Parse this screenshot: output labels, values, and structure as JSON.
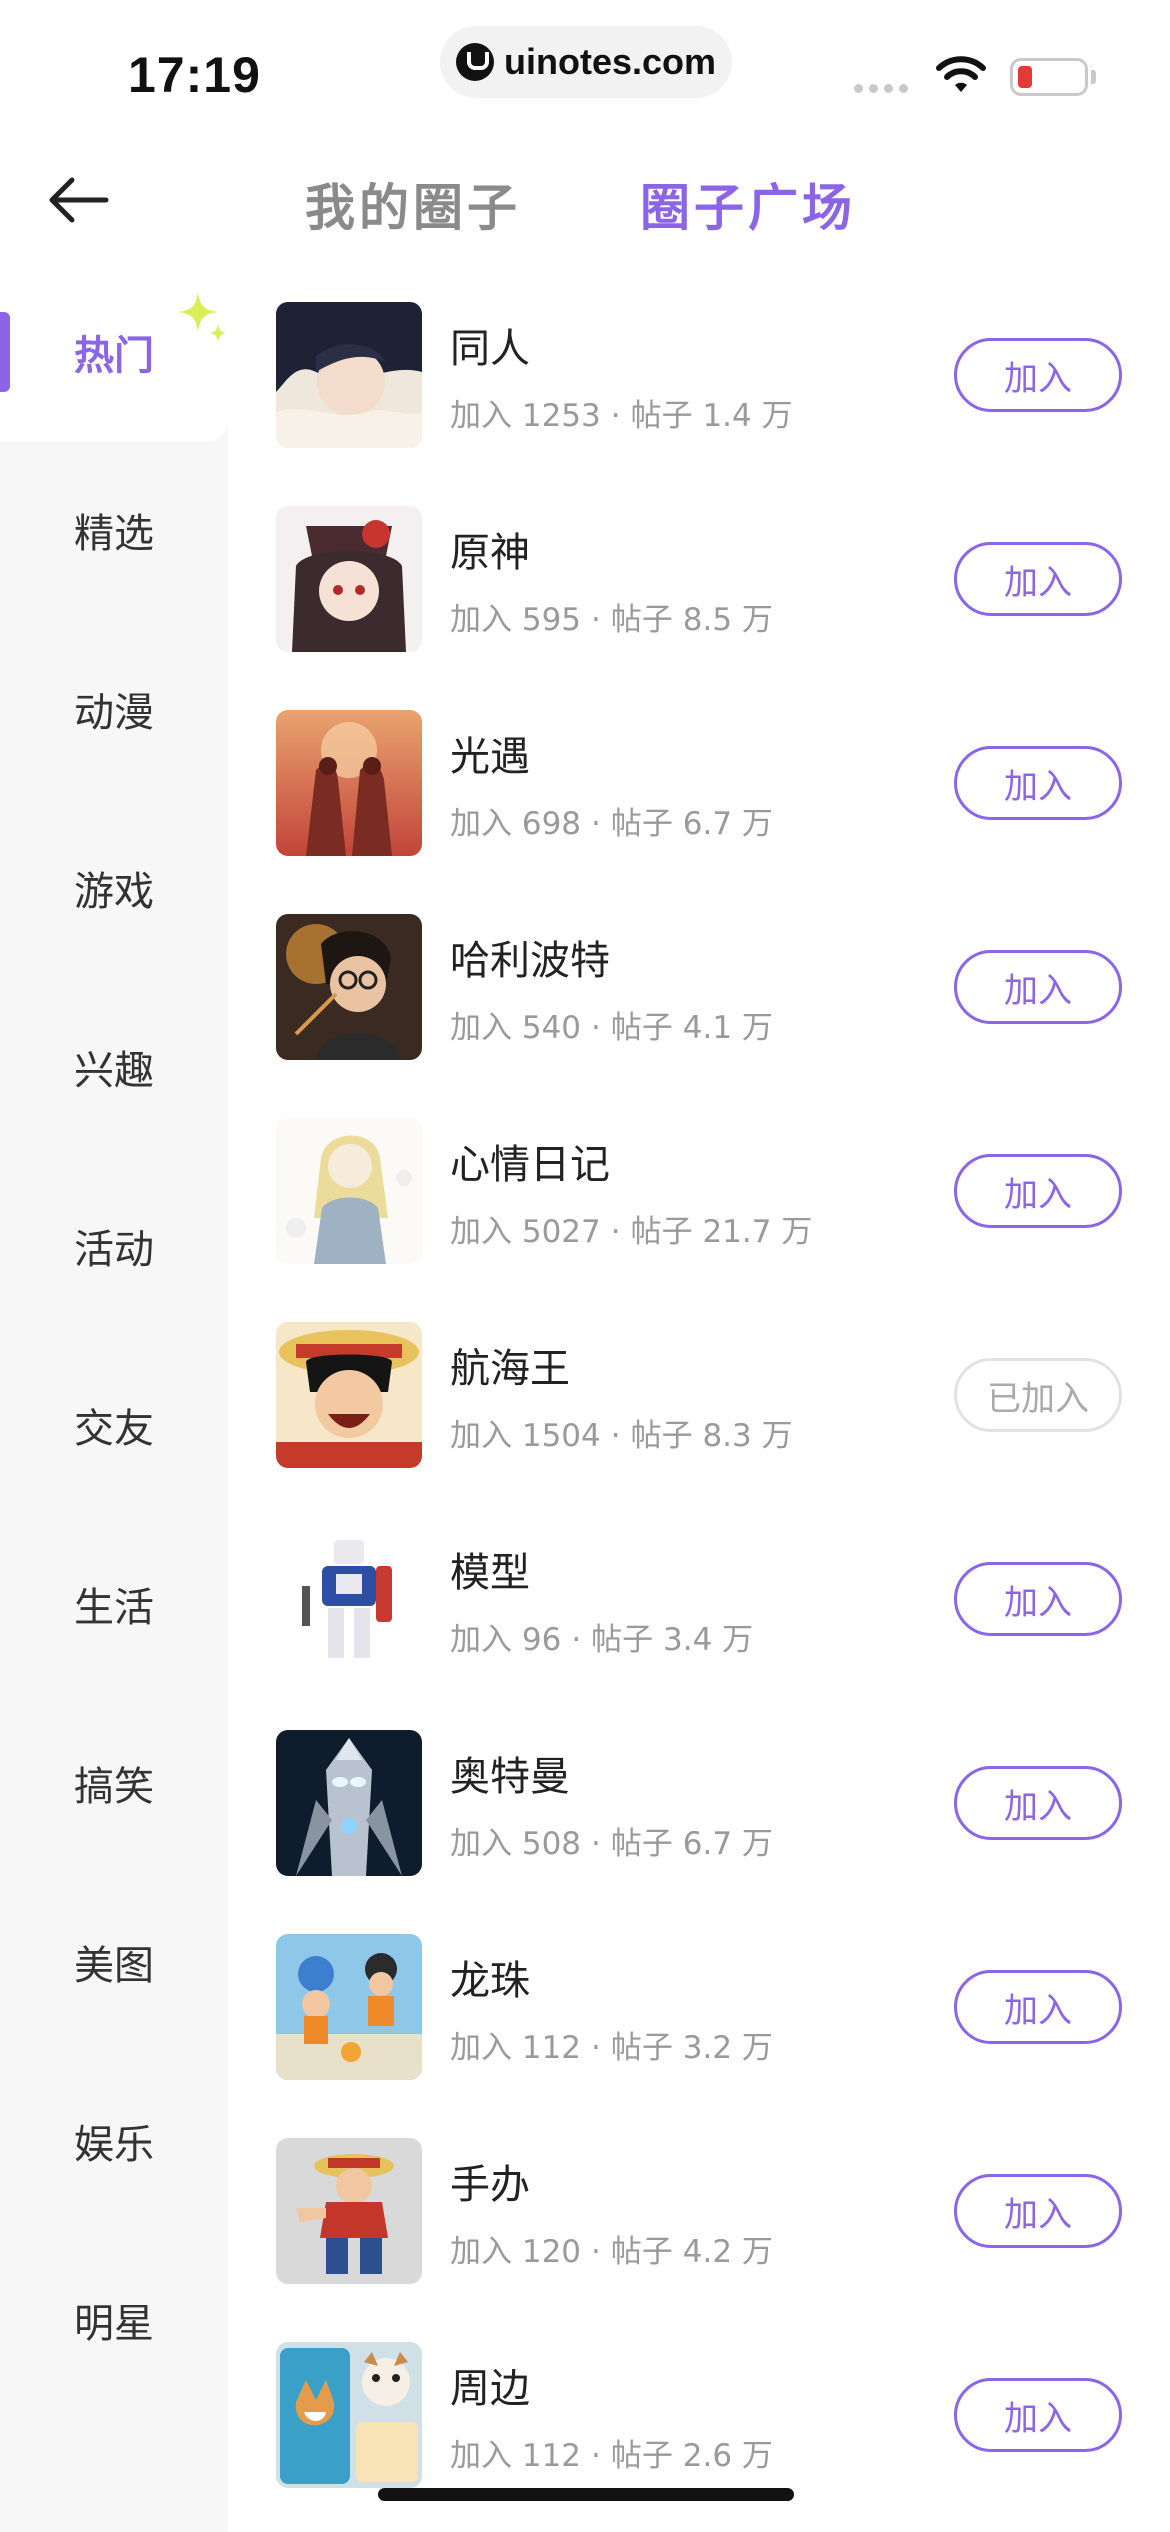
{
  "status_bar": {
    "time": "17:19",
    "url": "uinotes.com"
  },
  "header": {
    "back_icon": "arrow-left-icon",
    "tabs": [
      {
        "label": "我的圈子",
        "active": false
      },
      {
        "label": "圈子广场",
        "active": true
      }
    ]
  },
  "colors": {
    "accent": "#8b65e6",
    "sidebar_bg": "#f7f7f8",
    "muted_text": "#9a9a9a",
    "sparkle": "#d8ef5a"
  },
  "sidebar": {
    "items": [
      {
        "label": "热门",
        "active": true
      },
      {
        "label": "精选",
        "active": false
      },
      {
        "label": "动漫",
        "active": false
      },
      {
        "label": "游戏",
        "active": false
      },
      {
        "label": "兴趣",
        "active": false
      },
      {
        "label": "活动",
        "active": false
      },
      {
        "label": "交友",
        "active": false
      },
      {
        "label": "生活",
        "active": false
      },
      {
        "label": "搞笑",
        "active": false
      },
      {
        "label": "美图",
        "active": false
      },
      {
        "label": "娱乐",
        "active": false
      },
      {
        "label": "明星",
        "active": false
      }
    ]
  },
  "circles": [
    {
      "name": "同人",
      "joined_count": "加入 1253",
      "posts": "帖子 1.4 万",
      "button": "加入",
      "joined": false
    },
    {
      "name": "原神",
      "joined_count": "加入 595",
      "posts": "帖子 8.5 万",
      "button": "加入",
      "joined": false
    },
    {
      "name": "光遇",
      "joined_count": "加入 698",
      "posts": "帖子 6.7 万",
      "button": "加入",
      "joined": false
    },
    {
      "name": "哈利波特",
      "joined_count": "加入 540",
      "posts": "帖子 4.1 万",
      "button": "加入",
      "joined": false
    },
    {
      "name": "心情日记",
      "joined_count": "加入 5027",
      "posts": "帖子 21.7 万",
      "button": "加入",
      "joined": false
    },
    {
      "name": "航海王",
      "joined_count": "加入 1504",
      "posts": "帖子 8.3 万",
      "button": "已加入",
      "joined": true
    },
    {
      "name": "模型",
      "joined_count": "加入 96",
      "posts": "帖子 3.4 万",
      "button": "加入",
      "joined": false
    },
    {
      "name": "奥特曼",
      "joined_count": "加入 508",
      "posts": "帖子 6.7 万",
      "button": "加入",
      "joined": false
    },
    {
      "name": "龙珠",
      "joined_count": "加入 112",
      "posts": "帖子 3.2 万",
      "button": "加入",
      "joined": false
    },
    {
      "name": "手办",
      "joined_count": "加入 120",
      "posts": "帖子 4.2 万",
      "button": "加入",
      "joined": false
    },
    {
      "name": "周边",
      "joined_count": "加入 112",
      "posts": "帖子 2.6 万",
      "button": "加入",
      "joined": false
    }
  ],
  "separator": "·"
}
